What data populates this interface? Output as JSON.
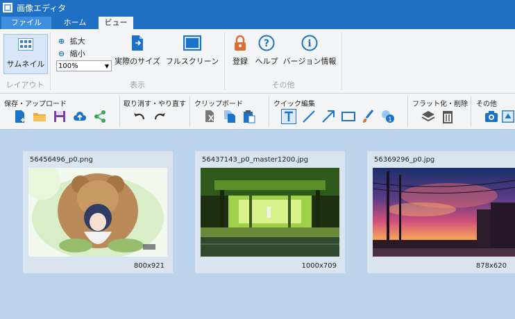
{
  "app": {
    "title": "画像エディタ"
  },
  "tabs": [
    {
      "label": "ファイル"
    },
    {
      "label": "ホーム"
    },
    {
      "label": "ビュー"
    }
  ],
  "ribbon": {
    "layout": {
      "thumbnail_label": "サムネイル",
      "group_label": "レイアウト"
    },
    "display": {
      "zoom_in_label": "拡大",
      "zoom_out_label": "縮小",
      "zoom_value": "100%",
      "actual_size_label": "実際のサイズ",
      "fullscreen_label": "フルスクリーン",
      "group_label": "表示"
    },
    "other": {
      "register_label": "登録",
      "help_label": "ヘルプ",
      "version_label": "バージョン情報",
      "group_label": "その他"
    }
  },
  "toolbar": {
    "groups": [
      {
        "label": "保存・アップロード"
      },
      {
        "label": "取り消す・やり直す"
      },
      {
        "label": "クリップボード"
      },
      {
        "label": "クイック編集"
      },
      {
        "label": "フラット化・削除"
      },
      {
        "label": "その他"
      }
    ]
  },
  "thumbnails": [
    {
      "filename": "56456496_p0.png",
      "dimensions": "800x921"
    },
    {
      "filename": "56437143_p0_master1200.jpg",
      "dimensions": "1000x709"
    },
    {
      "filename": "56369296_p0.jpg",
      "dimensions": "878x620"
    }
  ],
  "colors": {
    "titlebar": "#1f6fc2",
    "accent": "#1a73c9",
    "workspace": "#bcd3ec"
  }
}
